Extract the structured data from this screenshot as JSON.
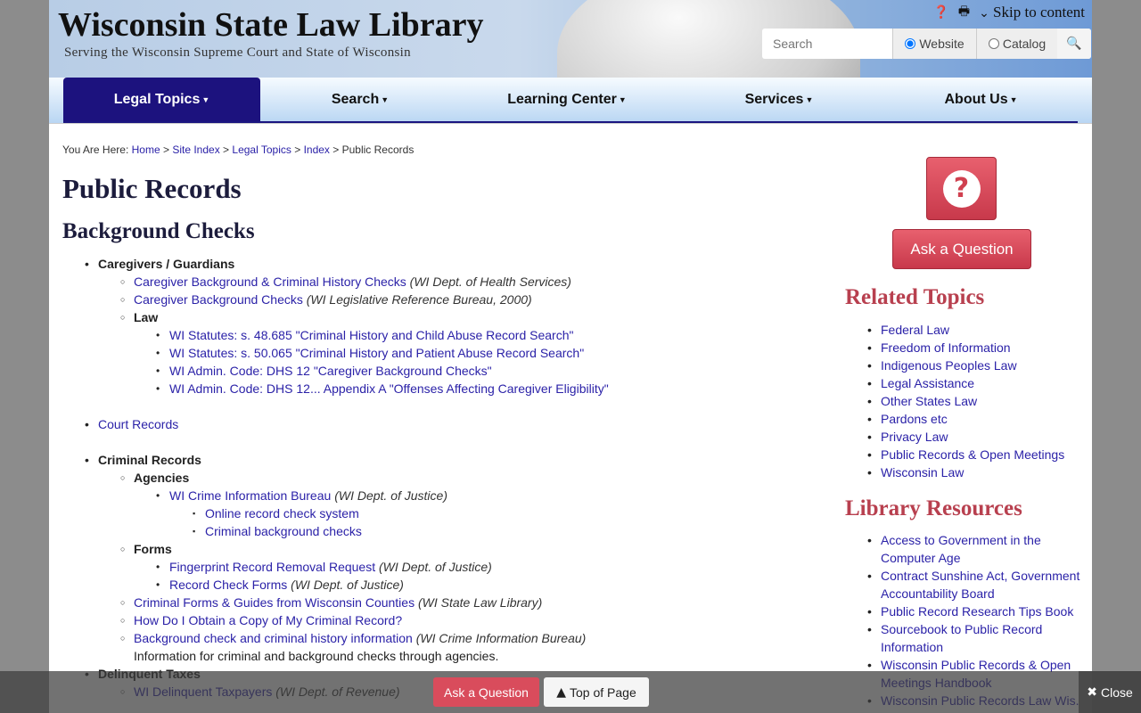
{
  "header": {
    "title": "Wisconsin State Law Library",
    "subtitle": "Serving the Wisconsin Supreme Court and State of Wisconsin",
    "skip": "Skip to content",
    "search_placeholder": "Search",
    "radio_website": "Website",
    "radio_catalog": "Catalog"
  },
  "nav": [
    "Legal Topics",
    "Search",
    "Learning Center",
    "Services",
    "About Us"
  ],
  "breadcrumb": {
    "prefix": "You Are Here:",
    "links": [
      "Home",
      "Site Index",
      "Legal Topics",
      "Index"
    ],
    "current": "Public Records"
  },
  "page_title": "Public Records",
  "section_title": "Background Checks",
  "list": [
    {
      "text": "Caregivers / Guardians",
      "bold": true,
      "children": [
        {
          "text": "Caregiver Background & Criminal History Checks",
          "link": true,
          "note": "(WI Dept. of Health Services)"
        },
        {
          "text": "Caregiver Background Checks",
          "link": true,
          "note": "(WI Legislative Reference Bureau, 2000)"
        },
        {
          "text": "Law",
          "bold": true,
          "children": [
            {
              "text": "WI Statutes: s. 48.685 \"Criminal History and Child Abuse Record Search\"",
              "link": true
            },
            {
              "text": "WI Statutes: s. 50.065 \"Criminal History and Patient Abuse Record Search\"",
              "link": true
            },
            {
              "text": "WI Admin. Code: DHS 12 \"Caregiver Background Checks\"",
              "link": true
            },
            {
              "text": "WI Admin. Code: DHS 12... Appendix A \"Offenses Affecting Caregiver Eligibility\"",
              "link": true
            }
          ]
        }
      ]
    },
    {
      "text": "Court Records",
      "link": true,
      "gap": true
    },
    {
      "text": "Criminal Records",
      "bold": true,
      "gap": true,
      "children": [
        {
          "text": "Agencies",
          "bold": true,
          "children": [
            {
              "text": "WI Crime Information Bureau",
              "link": true,
              "note": "(WI Dept. of Justice)",
              "children": [
                {
                  "text": "Online record check system",
                  "link": true
                },
                {
                  "text": "Criminal background checks",
                  "link": true
                }
              ]
            }
          ]
        },
        {
          "text": "Forms",
          "bold": true,
          "children": [
            {
              "text": "Fingerprint Record Removal Request",
              "link": true,
              "note": "(WI Dept. of Justice)"
            },
            {
              "text": "Record Check Forms",
              "link": true,
              "note": "(WI Dept. of Justice)"
            }
          ]
        },
        {
          "text": "Criminal Forms & Guides from Wisconsin Counties",
          "link": true,
          "note": "(WI State Law Library)"
        },
        {
          "text": "How Do I Obtain a Copy of My Criminal Record?",
          "link": true
        },
        {
          "text": "Background check and criminal history information",
          "link": true,
          "note": "(WI Crime Information Bureau)",
          "desc": "Information for criminal and background checks through agencies."
        }
      ]
    },
    {
      "text": "Delinquent Taxes",
      "bold": true,
      "children": [
        {
          "text": "WI Delinquent Taxpayers",
          "link": true,
          "note": "(WI Dept. of Revenue)"
        }
      ]
    }
  ],
  "sidebar": {
    "ask_label": "Ask a Question",
    "related_title": "Related Topics",
    "related": [
      "Federal Law",
      "Freedom of Information",
      "Indigenous Peoples Law",
      "Legal Assistance",
      "Other States Law",
      "Pardons etc",
      "Privacy Law",
      "Public Records & Open Meetings",
      "Wisconsin Law"
    ],
    "resources_title": "Library Resources",
    "resources": [
      "Access to Government in the Computer Age",
      "Contract Sunshine Act, Government Accountability Board",
      "Public Record Research Tips Book",
      "Sourcebook to Public Record Information",
      "Wisconsin Public Records & Open Meetings Handbook",
      "Wisconsin Public Records Law Wis."
    ]
  },
  "bottom": {
    "ask": "Ask a Question",
    "top": "Top of Page",
    "close": "Close"
  },
  "colors": {
    "nav_active": "#1c127e",
    "accent_red": "#d0404f",
    "link": "#2b22a8"
  }
}
